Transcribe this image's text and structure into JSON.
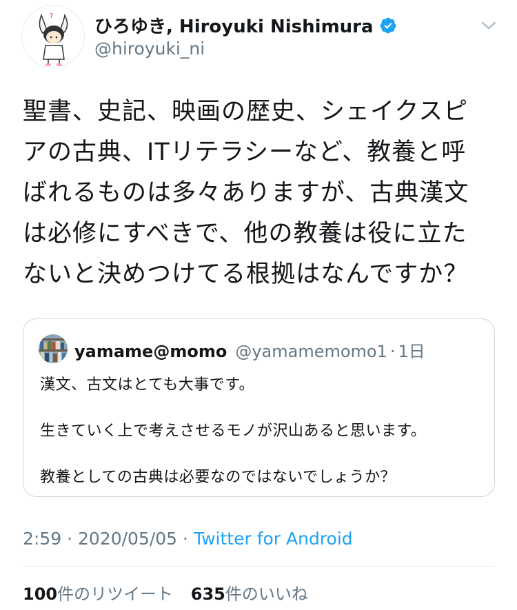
{
  "tweet": {
    "author": {
      "display_name": "ひろゆき, Hiroyuki Nishimura",
      "handle": "@hiroyuki_ni",
      "verified": true,
      "avatar_icon": "cartoon-character-avatar"
    },
    "text_lines": [
      "聖書、史記、映画の歴史、シェイクスピ",
      "アの古典、ITリテラシーなど、教養と呼",
      "ばれるものは多々ありますが、古典漢文",
      "は必修にすべきで、他の教養は役に立た",
      "ないと決めつけてる根拠はなんですか？"
    ],
    "quoted": {
      "display_name": "yamame@momo",
      "handle": "@yamamemomo1",
      "separator": "·",
      "time": "1日",
      "avatar_icon": "bookshelf-photo-avatar",
      "lines": [
        "漢文、古文はとても大事です。",
        "生きていく上で考えさせるモノが沢山あると思います。",
        "教養としての古典は必要なのではないでしょうか？"
      ]
    },
    "meta": {
      "time": "2:59",
      "separator": "·",
      "date": "2020/05/05",
      "client": "Twitter for Android"
    },
    "stats": {
      "retweets_count": "100",
      "retweets_label": "件のリツイート",
      "likes_count": "635",
      "likes_label": "件のいいね"
    }
  },
  "colors": {
    "text": "#14171a",
    "secondary": "#657786",
    "accent": "#1da1f2",
    "border": "#ccd6dd"
  }
}
